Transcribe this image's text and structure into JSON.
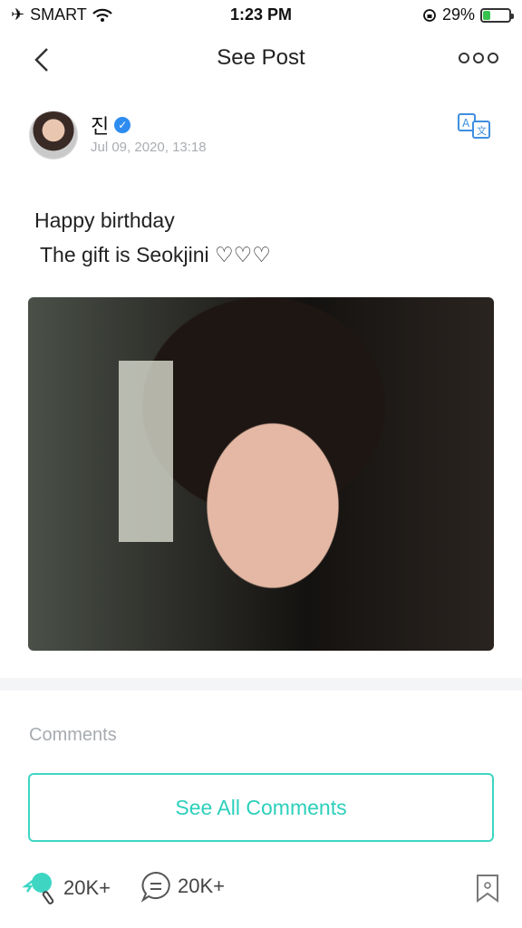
{
  "status_bar": {
    "carrier": "SMART",
    "time": "1:23 PM",
    "battery": "29%",
    "battery_level": 0.29
  },
  "header": {
    "title": "See Post",
    "back_icon": "chevron-left-icon",
    "more_icon": "ellipsis-icon"
  },
  "author": {
    "name": "진",
    "date": "Jul 09, 2020, 13:18",
    "verified": true,
    "translate_icon": "translate-icon"
  },
  "post": {
    "text": "Happy birthday\n The gift is Seokjini ♡♡♡"
  },
  "comments": {
    "label": "Comments",
    "see_all": "See All Comments"
  },
  "footer": {
    "likes": "20K+",
    "comments": "20K+",
    "bookmark_icon": "bookmark-icon"
  },
  "colors": {
    "accent": "#2cd0bb",
    "verified": "#2f8cf0"
  }
}
